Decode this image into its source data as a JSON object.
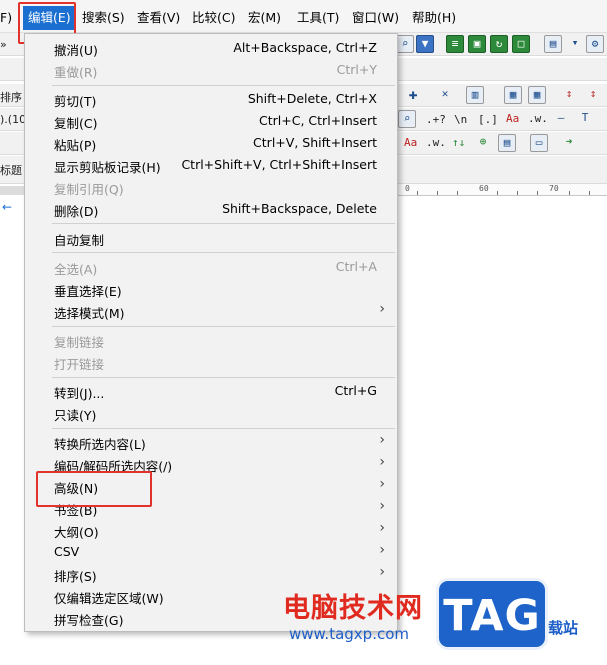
{
  "menubar": {
    "items": [
      {
        "label": "F)"
      },
      {
        "label": "编辑(E)"
      },
      {
        "label": "搜索(S)"
      },
      {
        "label": "查看(V)"
      },
      {
        "label": "比较(C)"
      },
      {
        "label": "宏(M)"
      },
      {
        "label": "工具(T)"
      },
      {
        "label": "窗口(W)"
      },
      {
        "label": "帮助(H)"
      }
    ]
  },
  "background": {
    "left_fragments": [
      "»",
      "排序",
      ").(10",
      "标题"
    ],
    "toolbar_symbols": [
      ".+?",
      "\\n",
      "[.]",
      "Aa",
      ".w.",
      ".w.",
      "↑↓"
    ],
    "ruler_numbers": [
      "0",
      "60",
      "70"
    ]
  },
  "edit_menu": {
    "items": [
      {
        "label": "撤消(U)",
        "shortcut": "Alt+Backspace, Ctrl+Z",
        "disabled": false
      },
      {
        "label": "重做(R)",
        "shortcut": "Ctrl+Y",
        "disabled": true
      },
      {
        "label": "剪切(T)",
        "shortcut": "Shift+Delete, Ctrl+X",
        "disabled": false
      },
      {
        "label": "复制(C)",
        "shortcut": "Ctrl+C, Ctrl+Insert",
        "disabled": false
      },
      {
        "label": "粘贴(P)",
        "shortcut": "Ctrl+V, Shift+Insert",
        "disabled": false
      },
      {
        "label": "显示剪贴板记录(H)",
        "shortcut": "Ctrl+Shift+V, Ctrl+Shift+Insert",
        "disabled": false
      },
      {
        "label": "复制引用(Q)",
        "shortcut": "",
        "disabled": true
      },
      {
        "label": "删除(D)",
        "shortcut": "Shift+Backspace, Delete",
        "disabled": false
      },
      {
        "label": "自动复制",
        "shortcut": "",
        "disabled": false
      },
      {
        "label": "全选(A)",
        "shortcut": "Ctrl+A",
        "disabled": true
      },
      {
        "label": "垂直选择(E)",
        "shortcut": "",
        "disabled": false
      },
      {
        "label": "选择模式(M)",
        "shortcut": "",
        "disabled": false,
        "submenu": true
      },
      {
        "label": "复制链接",
        "shortcut": "",
        "disabled": true
      },
      {
        "label": "打开链接",
        "shortcut": "",
        "disabled": true
      },
      {
        "label": "转到(J)...",
        "shortcut": "Ctrl+G",
        "disabled": false
      },
      {
        "label": "只读(Y)",
        "shortcut": "",
        "disabled": false
      },
      {
        "label": "转换所选内容(L)",
        "shortcut": "",
        "disabled": false,
        "submenu": true
      },
      {
        "label": "编码/解码所选内容(/)",
        "shortcut": "",
        "disabled": false,
        "submenu": true
      },
      {
        "label": "高级(N)",
        "shortcut": "",
        "disabled": false,
        "submenu": true
      },
      {
        "label": "书签(B)",
        "shortcut": "",
        "disabled": false,
        "submenu": true
      },
      {
        "label": "大纲(O)",
        "shortcut": "",
        "disabled": false,
        "submenu": true
      },
      {
        "label": "CSV",
        "shortcut": "",
        "disabled": false,
        "submenu": true
      },
      {
        "label": "排序(S)",
        "shortcut": "",
        "disabled": false,
        "submenu": true
      },
      {
        "label": "仅编辑选定区域(W)",
        "shortcut": "",
        "disabled": false
      },
      {
        "label": "拼写检查(G)",
        "shortcut": "",
        "disabled": false
      }
    ],
    "submenu_arrow": "›"
  },
  "watermark": {
    "title": "电脑技术网",
    "url": "www.tagxp.com",
    "logo": "TAG",
    "suffix": "载站"
  },
  "colors": {
    "highlight": "#e1332b",
    "active_menu": "#1a6fd1"
  }
}
